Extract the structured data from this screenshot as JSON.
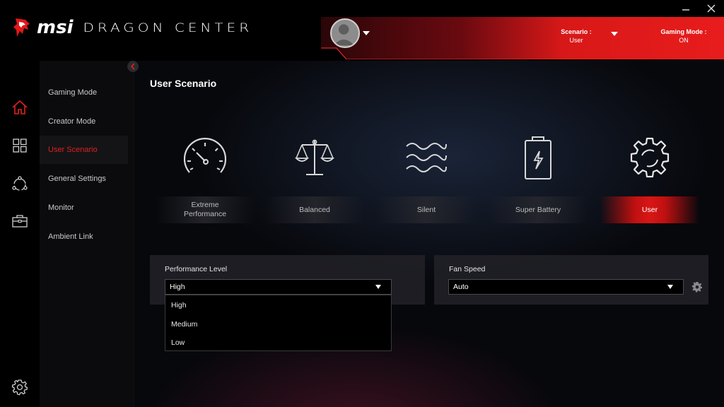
{
  "header": {
    "brand": "msi",
    "product": "DRAGON CENTER",
    "scenario_key": "Scenario :",
    "scenario_value": "User",
    "gaming_mode_key": "Gaming Mode :",
    "gaming_mode_value": "ON"
  },
  "rail": {
    "icons": [
      "home-icon",
      "grid-apps-icon",
      "network-icon",
      "toolbox-icon"
    ],
    "bottom_icon": "gear-icon"
  },
  "subnav": {
    "items": [
      {
        "label": "Gaming Mode"
      },
      {
        "label": "Creator Mode"
      },
      {
        "label": "User Scenario",
        "active": true
      },
      {
        "label": "General Settings"
      },
      {
        "label": "Monitor"
      },
      {
        "label": "Ambient Link"
      }
    ]
  },
  "main": {
    "title": "User Scenario",
    "scenarios": [
      {
        "label": "Extreme\nPerformance",
        "icon": "speedometer-icon"
      },
      {
        "label": "Balanced",
        "icon": "scale-icon"
      },
      {
        "label": "Silent",
        "icon": "waves-icon"
      },
      {
        "label": "Super Battery",
        "icon": "battery-icon"
      },
      {
        "label": "User",
        "icon": "gear-icon",
        "active": true
      }
    ],
    "performance": {
      "title": "Performance Level",
      "value": "High",
      "options": [
        "High",
        "Medium",
        "Low"
      ]
    },
    "fan": {
      "title": "Fan Speed",
      "value": "Auto"
    }
  },
  "colors": {
    "accent": "#e02020",
    "banner_red": "#e01818"
  }
}
